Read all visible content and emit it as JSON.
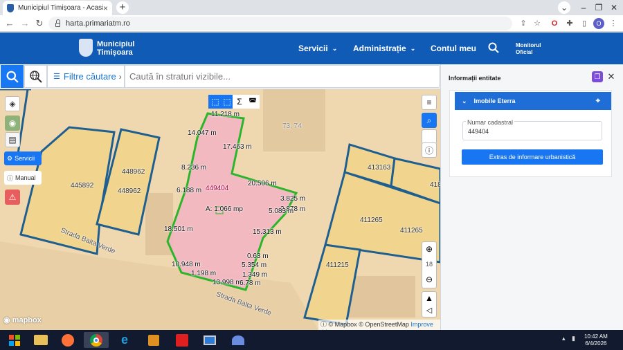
{
  "browser": {
    "tab_title": "Municipiul Timișoara - Acasă",
    "url": "harta.primariatm.ro",
    "close_tab": "×",
    "new_tab": "+",
    "profile_initial": "O"
  },
  "header": {
    "logo_line1": "Municipiul",
    "logo_line2": "Timișoara",
    "menu": [
      {
        "label": "Servicii"
      },
      {
        "label": "Administrație"
      },
      {
        "label": "Contul meu"
      }
    ],
    "monitor_line1": "Monitorul",
    "monitor_line2": "Oficial"
  },
  "search": {
    "filters_label": "Filtre căutare",
    "placeholder": "Caută în straturi vizibile..."
  },
  "map": {
    "side": {
      "servicii": "Servicii",
      "manual": "Manual"
    },
    "parcels": [
      {
        "label": "445892"
      },
      {
        "label": "448962"
      },
      {
        "label": "448962"
      },
      {
        "label": "413163"
      },
      {
        "label": "418"
      },
      {
        "label": "411265"
      },
      {
        "label": "411265"
      },
      {
        "label": "411215"
      },
      {
        "label": "73, 74"
      },
      {
        "label": "449404"
      }
    ],
    "streets": [
      "Strada Balta Verde",
      "Strada Balta Verde"
    ],
    "measurements": [
      "11.218 m",
      "14.047 m",
      "17.463 m",
      "8.236 m",
      "20.506 m",
      "6.188 m",
      "3.825 m",
      "2.878 m",
      "5.083 m",
      "A: 1.066 mp",
      "18.501 m",
      "15.313 m",
      "0.63 m",
      "10.948 m",
      "5.354 m",
      "1.198 m",
      "1.349 m",
      "13.998 m",
      "6.78 m"
    ],
    "zoom_level": "18",
    "attribution_mapbox": "© Mapbox",
    "attribution_osm": "© OpenStreetMap",
    "attribution_improve": "Improve this map",
    "logo": "mapbox"
  },
  "panel": {
    "title": "Informații entitate",
    "card_title": "Imobile Eterra",
    "field_label": "Numar cadastral",
    "field_value": "449404",
    "button_label": "Extras de informare urbanistică"
  },
  "taskbar": {
    "time": "10:42 AM",
    "date": "6/4/2026"
  },
  "colors": {
    "brand_blue": "#0f5bb5",
    "accent_blue": "#1976f2",
    "parcel_fill": "#f1d58e",
    "selected_fill": "#f3b4c3",
    "selected_border": "#2bb52b",
    "parcel_border": "#1f5f8f"
  }
}
